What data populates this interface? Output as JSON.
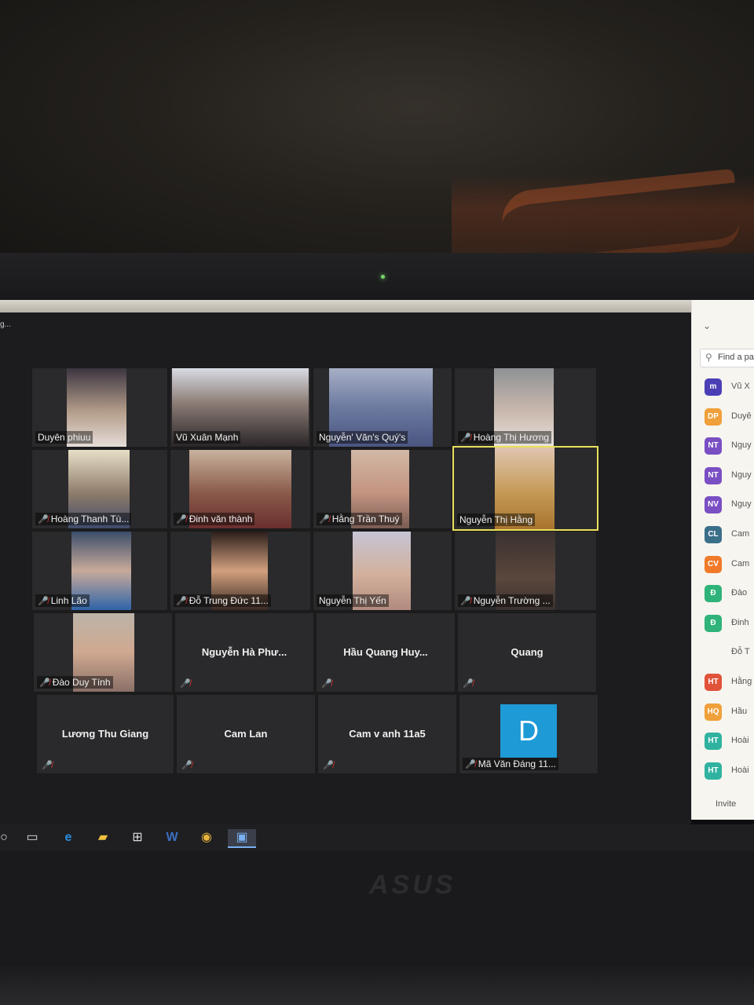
{
  "window": {
    "title": "g..."
  },
  "tiles": [
    {
      "name": "Duyên phiuu",
      "muted": false
    },
    {
      "name": "Vũ Xuân Mạnh",
      "muted": false
    },
    {
      "name": "Nguyễn' Văn's Quý's",
      "muted": false
    },
    {
      "name": "Hoàng Thị Hương",
      "muted": true
    },
    {
      "name": "Hoàng Thanh Tù...",
      "muted": true
    },
    {
      "name": "Đinh văn thành",
      "muted": true
    },
    {
      "name": "Hằng Trần Thuý",
      "muted": true
    },
    {
      "name": "Nguyễn Thị Hằng",
      "muted": false,
      "active": true
    },
    {
      "name": "Linh Lão",
      "muted": true
    },
    {
      "name": "Đỗ Trung Đức 11...",
      "muted": true
    },
    {
      "name": "Nguyễn Thị Yến",
      "muted": false
    },
    {
      "name": "Nguyễn Trường ...",
      "muted": true
    },
    {
      "name": "Đào Duy Tính",
      "muted": true
    },
    {
      "name": "Nguyễn Hà Phư...",
      "muted": true
    },
    {
      "name": "Hầu Quang Huy...",
      "muted": true
    },
    {
      "name": "Quang",
      "muted": true
    },
    {
      "name": "Lương Thu Giang",
      "muted": true
    },
    {
      "name": "Cam Lan",
      "muted": true
    },
    {
      "name": "Cam v anh 11a5",
      "muted": true
    },
    {
      "name": "Mã Văn Đáng 11...",
      "muted": true,
      "avatar_letter": "D"
    }
  ],
  "participants_panel": {
    "search_placeholder": "Find a pa",
    "invite_label": "Invite",
    "items": [
      {
        "initials": "m",
        "label": "Vũ X",
        "color": "#4a3fb5"
      },
      {
        "initials": "DP",
        "label": "Duyê",
        "color": "#f0a03a"
      },
      {
        "initials": "NT",
        "label": "Nguy",
        "color": "#7a4fc4"
      },
      {
        "initials": "NT",
        "label": "Nguy",
        "color": "#7a4fc4"
      },
      {
        "initials": "NV",
        "label": "Nguy",
        "color": "#7a4fc4"
      },
      {
        "initials": "CL",
        "label": "Cam",
        "color": "#3a6f8a"
      },
      {
        "initials": "CV",
        "label": "Cam",
        "color": "#f07a2a"
      },
      {
        "initials": "Đ",
        "label": "Đào",
        "color": "#2fb37a"
      },
      {
        "initials": "Đ",
        "label": "Đinh",
        "color": "#2fb37a"
      },
      {
        "initials": "",
        "label": "Đỗ T",
        "color": "#f7f5ef"
      },
      {
        "initials": "HT",
        "label": "Hằng",
        "color": "#e0533a"
      },
      {
        "initials": "HQ",
        "label": "Hầu",
        "color": "#f0a03a"
      },
      {
        "initials": "HT",
        "label": "Hoài",
        "color": "#2fb3a0"
      },
      {
        "initials": "HT",
        "label": "Hoài",
        "color": "#2fb3a0"
      }
    ]
  },
  "taskbar": [
    "task-view-icon",
    "edge-icon",
    "file-explorer-icon",
    "store-icon",
    "word-icon",
    "chrome-icon",
    "zoom-icon"
  ],
  "laptop": {
    "brand": "ASUS"
  }
}
